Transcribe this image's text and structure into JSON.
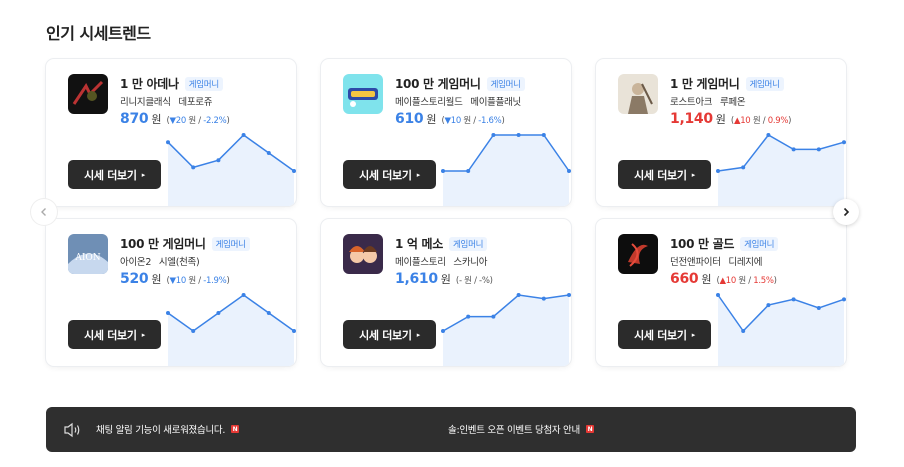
{
  "section": {
    "title": "인기 시세트렌드"
  },
  "cards": [
    {
      "amount": "1 만 아데나",
      "badge": "게임머니",
      "game": "리니지클래식",
      "server": "데포로쥬",
      "price": "870",
      "unit": "원",
      "dir": "down",
      "change_arrow": "▼",
      "change_value": "20",
      "change_unit": "원",
      "change_pct": "-2.2%",
      "button": "시세 더보기",
      "button_arrow": "▸",
      "icon": "lineage-classic-game-icon",
      "trend": [
        886,
        872,
        876,
        890,
        880,
        870
      ]
    },
    {
      "amount": "100 만 게임머니",
      "badge": "게임머니",
      "game": "메이플스토리월드",
      "server": "메이플플래닛",
      "price": "610",
      "unit": "원",
      "dir": "down",
      "change_arrow": "▼",
      "change_value": "10",
      "change_unit": "원",
      "change_pct": "-1.6%",
      "button": "시세 더보기",
      "button_arrow": "▸",
      "icon": "maplestory-worlds-game-icon",
      "trend": [
        610,
        610,
        620,
        620,
        620,
        610
      ]
    },
    {
      "amount": "1 만 게임머니",
      "badge": "게임머니",
      "game": "로스트아크",
      "server": "루페온",
      "price": "1,140",
      "unit": "원",
      "dir": "up",
      "change_arrow": "▲",
      "change_value": "10",
      "change_unit": "원",
      "change_pct": "0.9%",
      "button": "시세 더보기",
      "button_arrow": "▸",
      "icon": "lost-ark-game-icon",
      "trend": [
        1100,
        1105,
        1150,
        1130,
        1130,
        1140
      ]
    },
    {
      "amount": "100 만 게임머니",
      "badge": "게임머니",
      "game": "아이온2",
      "server": "시엘(천족)",
      "price": "520",
      "unit": "원",
      "dir": "down",
      "change_arrow": "▼",
      "change_value": "10",
      "change_unit": "원",
      "change_pct": "-1.9%",
      "button": "시세 더보기",
      "button_arrow": "▸",
      "icon": "aion2-game-icon",
      "trend": [
        540,
        520,
        540,
        560,
        540,
        520
      ]
    },
    {
      "amount": "1 억 메소",
      "badge": "게임머니",
      "game": "메이플스토리",
      "server": "스카니아",
      "price": "1,610",
      "unit": "원",
      "dir": "flat",
      "change_arrow": "",
      "change_value": "-",
      "change_unit": "원",
      "change_pct": "-%",
      "button": "시세 더보기",
      "button_arrow": "▸",
      "icon": "maplestory-game-icon",
      "trend": [
        1560,
        1580,
        1580,
        1610,
        1605,
        1610
      ]
    },
    {
      "amount": "100 만 골드",
      "badge": "게임머니",
      "game": "던전앤파이터",
      "server": "디레지에",
      "price": "660",
      "unit": "원",
      "dir": "up",
      "change_arrow": "▲",
      "change_value": "10",
      "change_unit": "원",
      "change_pct": "1.5%",
      "button": "시세 더보기",
      "button_arrow": "▸",
      "icon": "dungeon-fighter-game-icon",
      "trend": [
        665,
        640,
        658,
        662,
        656,
        662
      ]
    }
  ],
  "navigation": {
    "prev_icon": "chevron-left-icon",
    "next_icon": "chevron-right-icon"
  },
  "notices": {
    "icon": "speaker-icon",
    "items": [
      {
        "text": "채팅 알림 기능이 새로워졌습니다.",
        "badge": "N"
      },
      {
        "text": "솔:인벤트 오픈 이벤트 당첨자 안내",
        "badge": "N"
      }
    ]
  },
  "colors": {
    "up": "#e53935",
    "down": "#3b82e6",
    "accent": "#3b82e6",
    "button": "#2b2b2b",
    "notice_bg": "#2f2f2f"
  }
}
